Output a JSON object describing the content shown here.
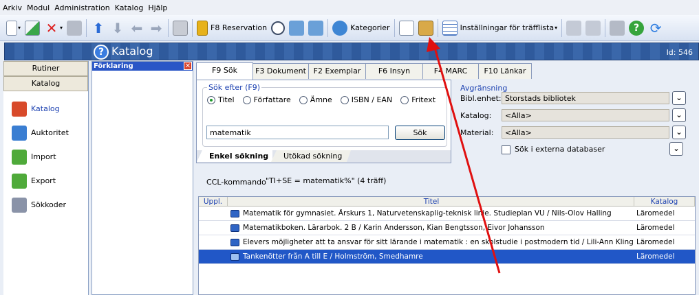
{
  "menu": [
    "Arkiv",
    "Modul",
    "Administration",
    "Katalog",
    "Hjälp"
  ],
  "toolbar": {
    "reservation_label": "F8 Reservation",
    "kategorier_label": "Kategorier",
    "installningar_label": "Inställningar för träfflista"
  },
  "window": {
    "title": "Katalog",
    "id_label": "Id: 546"
  },
  "nav": {
    "buttons": [
      "Rutiner",
      "Katalog"
    ],
    "items": [
      "Katalog",
      "Auktoritet",
      "Import",
      "Export",
      "Sökkoder"
    ]
  },
  "forklaring": {
    "header": "Förklaring"
  },
  "tabs": [
    "F9 Sök",
    "F3 Dokument",
    "F2 Exemplar",
    "F6 Insyn",
    "F4 MARC",
    "F10 Länkar"
  ],
  "search": {
    "legend": "Sök efter (F9)",
    "options": [
      "Titel",
      "Författare",
      "Ämne",
      "ISBN / EAN",
      "Fritext"
    ],
    "selected": "Titel",
    "value": "matematik",
    "button": "Sök",
    "subtabs": [
      "Enkel sökning",
      "Utökad sökning"
    ]
  },
  "avgransning": {
    "legend": "Avgränsning",
    "bibl_label": "Bibl.enhet:",
    "bibl_value": "Storstads bibliotek",
    "katalog_label": "Katalog:",
    "katalog_value": "<Alla>",
    "material_label": "Material:",
    "material_value": "<Alla>",
    "extern_label": "Sök i externa databaser"
  },
  "ccl": {
    "label": "CCL-kommando",
    "value": "\"TI+SE = matematik%\" (4 träff)"
  },
  "table": {
    "headers": [
      "Uppl.",
      "Titel",
      "Katalog"
    ],
    "rows": [
      {
        "title": "Matematik för gymnasiet. Årskurs 1, Naturvetenskaplig-teknisk linje. Studieplan VU / Nils-Olov Halling",
        "katalog": "Läromedel"
      },
      {
        "title": "Matematikboken. Lärarbok. 2 B / Karin Andersson, Kian Bengtsson, Eivor Johansson",
        "katalog": "Läromedel"
      },
      {
        "title": "Elevers möjligheter att ta ansvar för sitt lärande i matematik : en skolstudie i postmodern tid / Lili-Ann Kling Sackerud",
        "katalog": "Läromedel"
      },
      {
        "title": "Tankenötter från A till E / Holmström, Smedhamre",
        "katalog": "Läromedel"
      }
    ],
    "selected_row": 3
  },
  "colors": {
    "accent": "#2157c7",
    "annotation_arrow": "#e01010"
  }
}
